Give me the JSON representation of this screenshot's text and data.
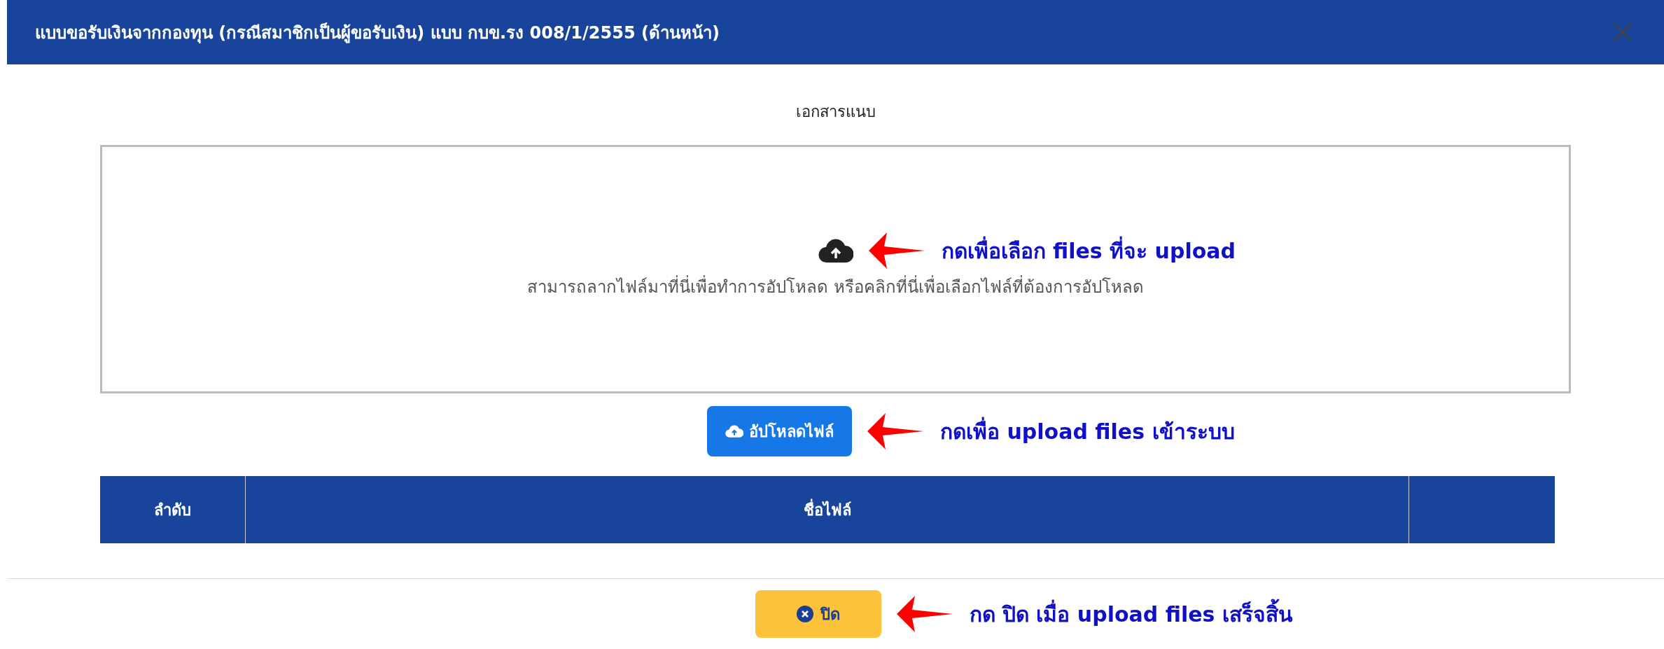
{
  "dialog": {
    "title": "แบบขอรับเงินจากกองทุน (กรณีสมาชิกเป็นผู้ขอรับเงิน) แบบ กบข.รง 008/1/2555 (ด้านหน้า)"
  },
  "attachments": {
    "heading": "เอกสารแนบ",
    "dropzone": {
      "text": "สามารถลากไฟล์มาที่นี่เพื่อทำการอัปโหลด หรือคลิกที่นี่เพื่อเลือกไฟล์ที่ต้องการอัปโหลด",
      "annotation": "กดเพื่อเลือก files ที่จะ upload"
    },
    "upload_button": {
      "label": "อัปโหลดไฟล์",
      "annotation": "กดเพื่อ upload files เข้าระบบ"
    }
  },
  "table": {
    "columns": [
      "ลำดับ",
      "ชื่อไฟล์"
    ]
  },
  "footer": {
    "close_button": {
      "label": "ปิด",
      "annotation": "กด ปิด เมื่อ upload files เสร็จสิ้น"
    }
  }
}
